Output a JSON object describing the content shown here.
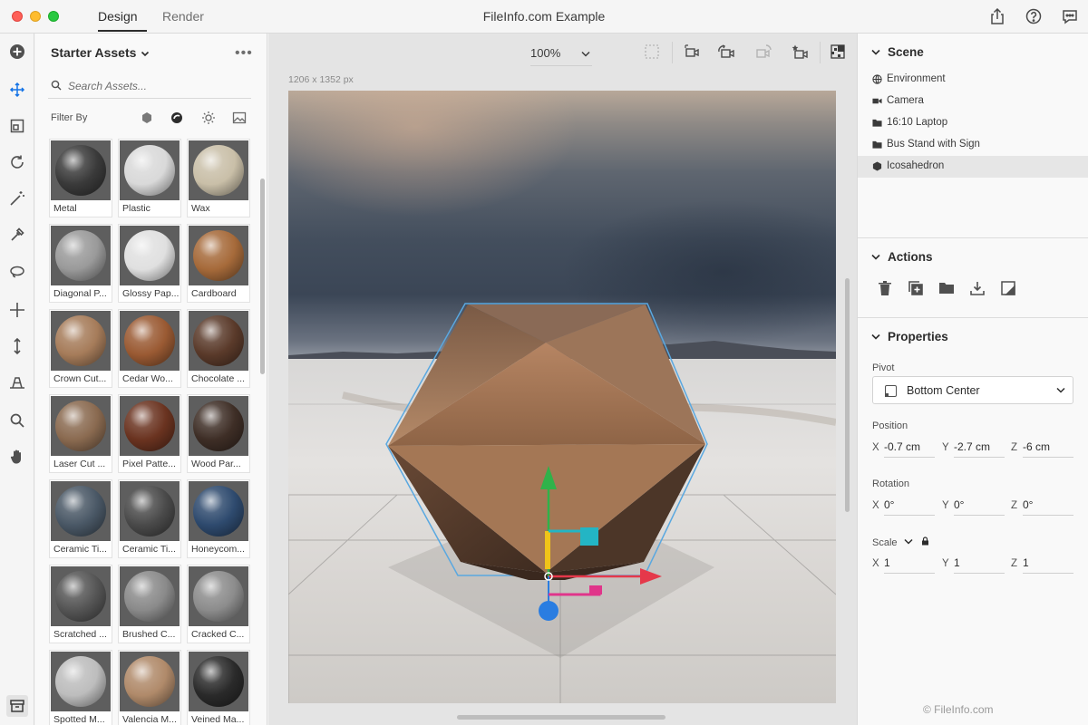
{
  "window": {
    "title": "FileInfo.com Example",
    "tabs": [
      {
        "label": "Design",
        "active": true
      },
      {
        "label": "Render",
        "active": false
      }
    ],
    "right_icons": [
      "share-icon",
      "help-icon",
      "feedback-icon"
    ]
  },
  "toolrail": {
    "tools": [
      "add-icon",
      "select-icon",
      "artboard-icon",
      "orbit-icon",
      "magic-wand-icon",
      "eyedropper-icon",
      "lasso-icon",
      "move-icon",
      "dolly-icon",
      "perspective-icon",
      "zoom-icon",
      "hand-icon"
    ],
    "bottom": "assets-panel-icon",
    "active_tool": "select-icon"
  },
  "assets": {
    "title": "Starter Assets",
    "search_placeholder": "Search Assets...",
    "filter_label": "Filter By",
    "filters": [
      "models-filter-icon",
      "materials-filter-icon",
      "lights-filter-icon",
      "images-filter-icon"
    ],
    "items": [
      {
        "label": "Metal",
        "color": "#3a3a3a"
      },
      {
        "label": "Plastic",
        "color": "#d9d9d9"
      },
      {
        "label": "Wax",
        "color": "#c9bfa8"
      },
      {
        "label": "Diagonal P...",
        "color": "#9a9a9a"
      },
      {
        "label": "Glossy Pap...",
        "color": "#e0e0e0"
      },
      {
        "label": "Cardboard",
        "color": "#a66a3a"
      },
      {
        "label": "Crown Cut...",
        "color": "#a67c5a"
      },
      {
        "label": "Cedar Wo...",
        "color": "#9a5a33"
      },
      {
        "label": "Chocolate ...",
        "color": "#5a3a2a"
      },
      {
        "label": "Laser Cut ...",
        "color": "#8a6a50"
      },
      {
        "label": "Pixel Patte...",
        "color": "#6a3320"
      },
      {
        "label": "Wood Par...",
        "color": "#3e2e26"
      },
      {
        "label": "Ceramic Ti...",
        "color": "#4a5866"
      },
      {
        "label": "Ceramic Ti...",
        "color": "#4a4a4a"
      },
      {
        "label": "Honeycom...",
        "color": "#2e4a6e"
      },
      {
        "label": "Scratched ...",
        "color": "#555555"
      },
      {
        "label": "Brushed C...",
        "color": "#8a8a8a"
      },
      {
        "label": "Cracked C...",
        "color": "#8c8c8c"
      },
      {
        "label": "Spotted M...",
        "color": "#bdbdbd"
      },
      {
        "label": "Valencia M...",
        "color": "#b08a6a"
      },
      {
        "label": "Veined Ma...",
        "color": "#2a2a2a"
      }
    ]
  },
  "canvas": {
    "zoom": "100%",
    "dimensions": "1206 x 1352 px",
    "toolbar_icons": [
      "fit-icon",
      "camera-view-icon",
      "camera-bookmark-icon",
      "camera-next-icon",
      "camera-favorite-icon",
      "render-preview-icon"
    ]
  },
  "scene": {
    "title": "Scene",
    "items": [
      {
        "label": "Environment",
        "icon": "globe-icon"
      },
      {
        "label": "Camera",
        "icon": "camera-icon"
      },
      {
        "label": "16:10 Laptop",
        "icon": "folder-icon"
      },
      {
        "label": "Bus Stand with Sign",
        "icon": "folder-icon"
      },
      {
        "label": "Icosahedron",
        "icon": "cube-icon",
        "selected": true
      }
    ]
  },
  "actions": {
    "title": "Actions",
    "icons": [
      "delete-icon",
      "duplicate-icon",
      "group-icon",
      "download-icon",
      "material-icon"
    ]
  },
  "properties": {
    "title": "Properties",
    "pivot_label": "Pivot",
    "pivot_value": "Bottom Center",
    "position_label": "Position",
    "position": {
      "x": "-0.7 cm",
      "y": "-2.7 cm",
      "z": "-6 cm"
    },
    "rotation_label": "Rotation",
    "rotation": {
      "x": "0°",
      "y": "0°",
      "z": "0°"
    },
    "scale_label": "Scale",
    "scale": {
      "x": "1",
      "y": "1",
      "z": "1"
    },
    "axis_labels": {
      "x": "X",
      "y": "Y",
      "z": "Z"
    }
  },
  "watermark": "© FileInfo.com"
}
